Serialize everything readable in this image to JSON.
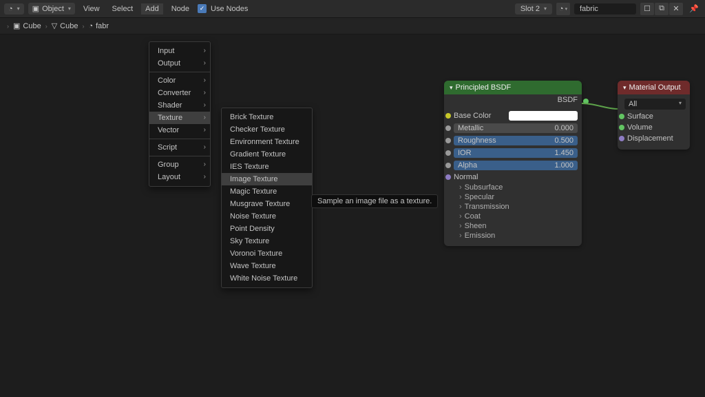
{
  "toolbar": {
    "mode_label": "Object",
    "menus": [
      "View",
      "Select",
      "Add",
      "Node"
    ],
    "use_nodes_label": "Use Nodes",
    "slot_label": "Slot 2",
    "material_name": "fabric"
  },
  "breadcrumb": [
    "Cube",
    "Cube",
    "fabr"
  ],
  "add_menu": {
    "groups": [
      [
        "Input",
        "Output"
      ],
      [
        "Color",
        "Converter",
        "Shader",
        "Texture",
        "Vector"
      ],
      [
        "Script"
      ],
      [
        "Group",
        "Layout"
      ]
    ],
    "highlight": "Texture"
  },
  "texture_menu": {
    "items": [
      "Brick Texture",
      "Checker Texture",
      "Environment Texture",
      "Gradient Texture",
      "IES Texture",
      "Image Texture",
      "Magic Texture",
      "Musgrave Texture",
      "Noise Texture",
      "Point Density",
      "Sky Texture",
      "Voronoi Texture",
      "Wave Texture",
      "White Noise Texture"
    ],
    "highlight": "Image Texture",
    "tooltip": "Sample an image file as a texture."
  },
  "principled": {
    "title": "Principled BSDF",
    "output": "BSDF",
    "base_color_label": "Base Color",
    "params": [
      {
        "name": "Metallic",
        "value": "0.000",
        "blue": false
      },
      {
        "name": "Roughness",
        "value": "0.500",
        "blue": true
      },
      {
        "name": "IOR",
        "value": "1.450",
        "blue": true
      },
      {
        "name": "Alpha",
        "value": "1.000",
        "blue": true
      }
    ],
    "normal_label": "Normal",
    "expanders": [
      "Subsurface",
      "Specular",
      "Transmission",
      "Coat",
      "Sheen",
      "Emission"
    ]
  },
  "material_output": {
    "title": "Material Output",
    "target": "All",
    "inputs": [
      "Surface",
      "Volume",
      "Displacement"
    ]
  }
}
